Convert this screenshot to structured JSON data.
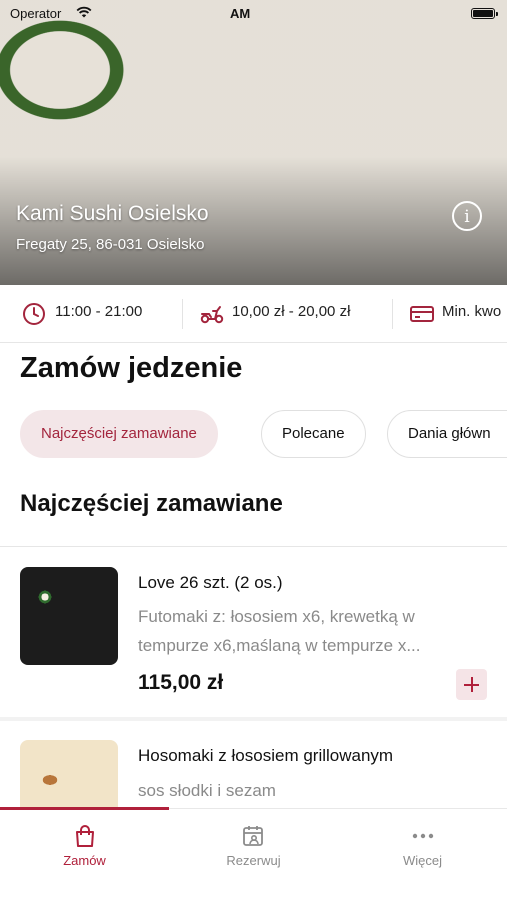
{
  "status_bar": {
    "operator": "Operator",
    "time": "AM"
  },
  "restaurant": {
    "name": "Kami Sushi Osielsko",
    "address": "Fregaty 25, 86-031 Osielsko"
  },
  "info_strip": {
    "hours": "11:00 - 21:00",
    "delivery_fee": "10,00 zł - 20,00 zł",
    "min_order": "Min. kwo"
  },
  "page": {
    "title": "Zamów jedzenie",
    "list_title": "Najczęściej zamawiane"
  },
  "categories": [
    "Najczęściej zamawiane",
    "Polecane",
    "Dania główn"
  ],
  "products": [
    {
      "name": "Love 26 szt. (2 os.)",
      "desc_line1": "Futomaki z: łososiem x6, krewetką w",
      "desc_line2": "tempurze x6,maślaną w tempurze x...",
      "price": "115,00 zł"
    },
    {
      "name": "Hosomaki z łososiem grillowanym",
      "desc_line1": "sos słodki i sezam"
    }
  ],
  "tab_bar": {
    "order": "Zamów",
    "reserve": "Rezerwuj",
    "more": "Więcej"
  },
  "colors": {
    "accent": "#b0203b",
    "chip_active_bg": "#f3e6e8"
  }
}
